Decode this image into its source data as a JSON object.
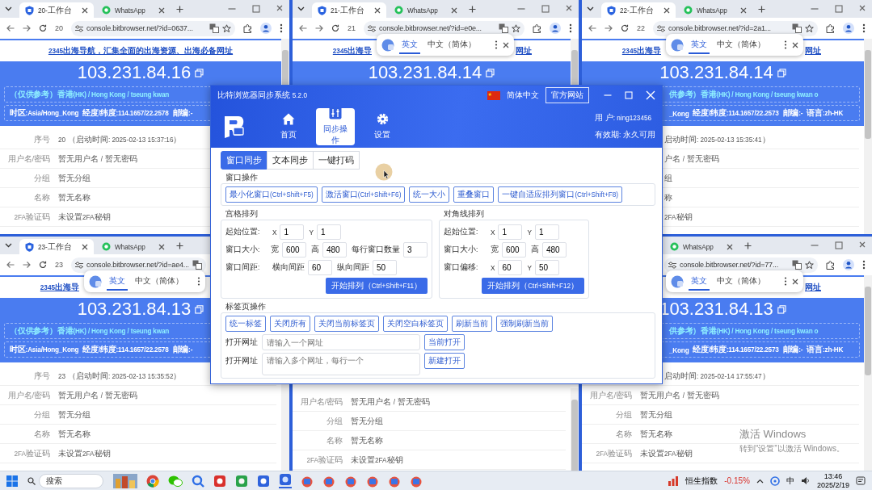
{
  "windows": [
    {
      "tabs": [
        {
          "label": "20-工作台",
          "selected": true,
          "kind": "workspace"
        },
        {
          "label": "WhatsApp",
          "selected": false,
          "kind": "whatsapp"
        }
      ],
      "tab_number": "20",
      "url": "console.bitbrowser.net/?id=0637...",
      "banner": "2345出海导航，汇集全面的出海资源、出海必备网址",
      "ip": "103.231.84.16",
      "location": "（仅供参考）香港(HK) / Hong Kong / tseung kwan",
      "geo": [
        "时区:Asia/Hong_Kong",
        "经度/纬度:114.1657/22.2578",
        "邮编:-"
      ],
      "rows": [
        {
          "label": "序号",
          "value": "20 （启动时间: 2025-02-13 15:37:16）"
        },
        {
          "label": "用户名/密码",
          "value": "暂无用户名 / 暂无密码"
        },
        {
          "label": "分组",
          "value": "暂无分组"
        },
        {
          "label": "名称",
          "value": "暂无名称"
        },
        {
          "label": "2FA验证码",
          "value": "未设置2FA秘钥"
        }
      ]
    },
    {
      "tabs": [
        {
          "label": "21-工作台",
          "selected": true,
          "kind": "workspace"
        },
        {
          "label": "WhatsApp",
          "selected": false,
          "kind": "whatsapp"
        }
      ],
      "tab_number": "21",
      "url": "console.bitbrowser.net/?id=e0e...",
      "popup": {
        "tabs": [
          {
            "label": "英文",
            "selected": true
          },
          {
            "label": "中文（简体）",
            "selected": false
          }
        ]
      },
      "banner_before": "2345出海导",
      "banner_after": "网址",
      "ip": "103.231.84.14"
    },
    {
      "tabs": [
        {
          "label": "22-工作台",
          "selected": true,
          "kind": "workspace"
        },
        {
          "label": "WhatsApp",
          "selected": false,
          "kind": "whatsapp"
        }
      ],
      "tab_number": "22",
      "url": "console.bitbrowser.net/?id=2a1...",
      "popup": {
        "tabs": [
          {
            "label": "英文",
            "selected": true
          },
          {
            "label": "中文（简体）",
            "selected": false
          }
        ]
      },
      "banner_before": "2345出海导",
      "banner_after": "网址",
      "ip": "103.231.84.14",
      "location": "供参考）香港(HK) / Hong Kong / tseung kwan o",
      "geo": [
        "_Kong",
        "经度/纬度:114.1657/22.2573",
        "邮编:-",
        "语言:zh-HK"
      ],
      "rows": [
        {
          "value": "启动时间: 2025-02-13 15:35:41）"
        },
        {
          "value": "户名 / 暂无密码"
        },
        {
          "value": "组"
        },
        {
          "value": "称"
        },
        {
          "value": "2FA秘钥"
        }
      ]
    },
    {
      "tabs": [
        {
          "label": "23-工作台",
          "selected": true,
          "kind": "workspace"
        },
        {
          "label": "WhatsApp",
          "selected": false,
          "kind": "whatsapp"
        }
      ],
      "tab_number": "23",
      "url": "console.bitbrowser.net/?id=ae4...",
      "popup": {
        "tabs": [
          {
            "label": "英文",
            "selected": true
          },
          {
            "label": "中文（简体）",
            "selected": false
          }
        ]
      },
      "banner_before": "2345出海导",
      "ip": "103.231.84.13",
      "location": "（仅供参考）香港(HK) / Hong Kong / tseung kwan",
      "geo": [
        "时区:Asia/Hong_Kong",
        "经度/纬度:114.1657/22.2578",
        "邮编:-"
      ],
      "rows": [
        {
          "label": "序号",
          "value": "23 （启动时间: 2025-02-13 15:35:52）"
        },
        {
          "label": "用户名/密码",
          "value": "暂无用户名 / 暂无密码"
        },
        {
          "label": "分组",
          "value": "暂无分组"
        },
        {
          "label": "名称",
          "value": "暂无名称"
        },
        {
          "label": "2FA验证码",
          "value": "未设置2FA秘钥"
        }
      ]
    },
    {
      "rows": [
        {
          "label": "用户名/密码",
          "value": "暂无用户名 / 暂无密码"
        },
        {
          "label": "分组",
          "value": "暂无分组"
        },
        {
          "label": "名称",
          "value": "暂无名称"
        },
        {
          "label": "2FA验证码",
          "value": "未设置2FA秘钥"
        }
      ]
    },
    {
      "tabs": [
        {
          "label": "WhatsApp",
          "selected": false,
          "kind": "whatsapp"
        }
      ],
      "url": "console.bitbrowser.net/?id=77...",
      "popup": {
        "tabs": [
          {
            "label": "英文",
            "selected": true
          },
          {
            "label": "中文（简体）",
            "selected": false
          }
        ]
      },
      "banner_after": "网址",
      "ip": "103.231.84.13",
      "location": "供参考）香港(HK) / Hong Kong / tseung kwan o",
      "geo": [
        "_Kong",
        "经度/纬度:114.1657/22.2573",
        "邮编:-",
        "语言:zh-HK"
      ],
      "rows": [
        {
          "value": "启动时间: 2025-02-14 17:55:47）"
        },
        {
          "label": "用户名/密码",
          "value": "暂无用户名 / 暂无密码"
        },
        {
          "label": "分组",
          "value": "暂无分组"
        },
        {
          "label": "名称",
          "value": "暂无名称"
        },
        {
          "label": "2FA验证码",
          "value": "未设置2FA秘钥"
        }
      ]
    }
  ],
  "sync_dialog": {
    "title": "比特浏览器同步系统 5.2.0",
    "language": "简体中文",
    "website_button": "官方网站",
    "nav": [
      {
        "label": "首页",
        "selected": false,
        "kind": "home"
      },
      {
        "label": "同步操作",
        "selected": true,
        "kind": "sync"
      },
      {
        "label": "设置",
        "selected": false,
        "kind": "settings"
      }
    ],
    "user": "用 户: ning123456",
    "expiry": "有效期: 永久可用",
    "tabs": [
      {
        "label": "窗口同步",
        "selected": true
      },
      {
        "label": "文本同步",
        "selected": false
      },
      {
        "label": "一键打码",
        "selected": false
      }
    ],
    "window_ops": {
      "title": "窗口操作",
      "buttons": [
        "最小化窗口(Ctrl+Shift+F5)",
        "激活窗口(Ctrl+Shift+F6)",
        "统一大小",
        "重叠窗口",
        "一键自适应排列窗口(Ctrl+Shift+F8)"
      ]
    },
    "grid_arrange": {
      "title": "宫格排列",
      "rows": [
        {
          "label": "起始位置:",
          "fields": [
            {
              "prefix": "X",
              "value": "1"
            },
            {
              "prefix": "Y",
              "value": "1"
            }
          ]
        },
        {
          "label": "窗口大小:",
          "fields": [
            {
              "prefix": "宽",
              "value": "600"
            },
            {
              "prefix": "高",
              "value": "480"
            },
            {
              "prefix": "每行窗口数量",
              "value": "3"
            }
          ]
        },
        {
          "label": "窗口间距:",
          "fields": [
            {
              "prefix": "横向间距",
              "value": "60"
            },
            {
              "prefix": "纵向间距",
              "value": "50"
            }
          ]
        }
      ],
      "button": "开始排列（Ctrl+Shift+F11）"
    },
    "diagonal_arrange": {
      "title": "对角线排列",
      "rows": [
        {
          "label": "起始位置:",
          "fields": [
            {
              "prefix": "X",
              "value": "1"
            },
            {
              "prefix": "Y",
              "value": "1"
            }
          ]
        },
        {
          "label": "窗口大小:",
          "fields": [
            {
              "prefix": "宽",
              "value": "600"
            },
            {
              "prefix": "高",
              "value": "480"
            }
          ]
        },
        {
          "label": "窗口偏移:",
          "fields": [
            {
              "prefix": "X",
              "value": "60"
            },
            {
              "prefix": "Y",
              "value": "50"
            }
          ]
        }
      ],
      "button": "开始排列（Ctrl+Shift+F12）"
    },
    "tab_ops": {
      "title": "标签页操作",
      "buttons": [
        "统一标签",
        "关闭所有",
        "关闭当前标签页",
        "关闭空白标签页",
        "刷新当前",
        "强制刷新当前"
      ],
      "url_rows": [
        {
          "label": "打开网址",
          "kind": "input",
          "placeholder": "请输入一个网址",
          "button": "当前打开"
        },
        {
          "label": "打开网址",
          "kind": "textarea",
          "placeholder": "请输入多个网址，每行一个",
          "button": "新建打开"
        }
      ]
    }
  },
  "watermark": {
    "title": "激活 Windows",
    "hint": "转到“设置”以激活 Windows。"
  },
  "taskbar": {
    "search": {
      "placeholder": "搜索"
    },
    "stock": {
      "name": "恒生指数",
      "change": "-0.15%"
    },
    "ime": "中",
    "time": "13:46",
    "date": "2025/2/19"
  }
}
